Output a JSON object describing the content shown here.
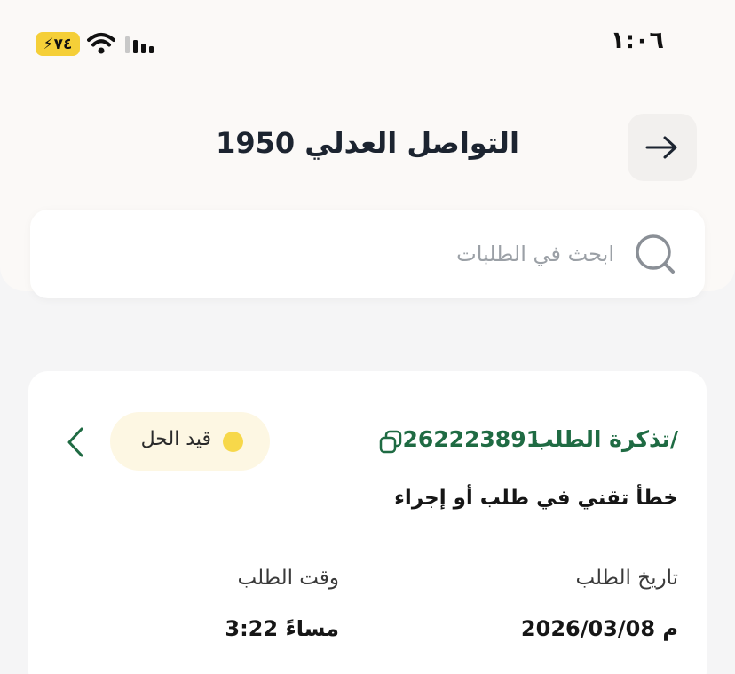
{
  "status_bar": {
    "time": "١:٠٦",
    "battery": "٧٤"
  },
  "header": {
    "title": "التواصل العدلي 1950",
    "back_icon": "arrow-right-icon"
  },
  "search": {
    "placeholder": "ابحث في الطلبات",
    "icon": "search-icon"
  },
  "requests": [
    {
      "ticket_label": "تذكرة الطلب/",
      "ticket_number": "262223891",
      "status": "قيد الحل",
      "subject": "خطأ تقني في طلب أو إجراء",
      "date_label": "تاريخ الطلب",
      "date_value": "2026/03/08 م",
      "time_label": "وقت الطلب",
      "time_value": "3:22 مساءً"
    }
  ],
  "colors": {
    "accent_green": "#1f6b43",
    "status_yellow": "#f7d84a",
    "badge_bg": "#fdf7e3"
  }
}
